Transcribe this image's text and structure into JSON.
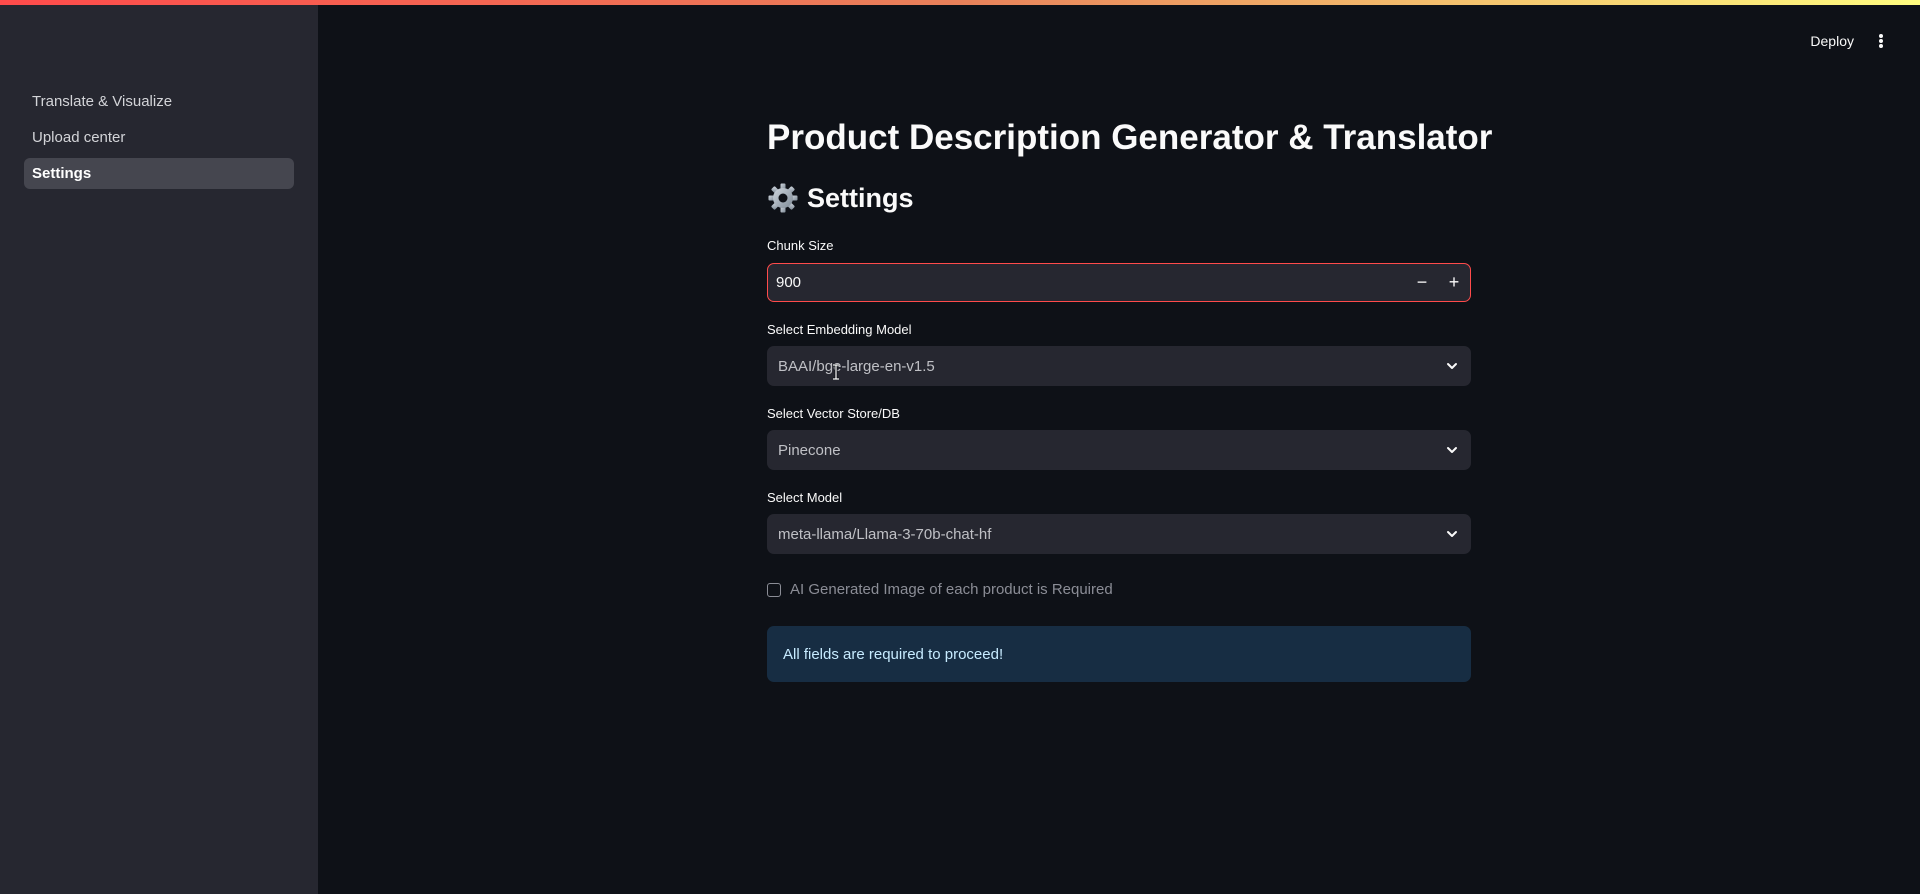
{
  "sidebar": {
    "items": [
      {
        "label": "Translate & Visualize",
        "active": false
      },
      {
        "label": "Upload center",
        "active": false
      },
      {
        "label": "Settings",
        "active": true
      }
    ]
  },
  "header": {
    "deploy_label": "Deploy",
    "menu_icon": "vertical-ellipsis-icon"
  },
  "main": {
    "title": "Product Description Generator & Translator",
    "section_title": "Settings",
    "section_icon": "gear-icon",
    "chunk_size": {
      "label": "Chunk Size",
      "value": "900",
      "decrement_label": "−",
      "increment_label": "+"
    },
    "embedding_model": {
      "label": "Select Embedding Model",
      "value": "BAAI/bge-large-en-v1.5"
    },
    "vector_store": {
      "label": "Select Vector Store/DB",
      "value": "Pinecone"
    },
    "model": {
      "label": "Select Model",
      "value": "meta-llama/Llama-3-70b-chat-hf"
    },
    "image_checkbox": {
      "label": "AI Generated Image of each product is Required",
      "checked": false
    },
    "alert": "All fields are required to proceed!"
  },
  "colors": {
    "background": "#0e1117",
    "sidebar": "#262730",
    "accent": "#ff4b4b",
    "info_bg": "#172d43",
    "info_text": "#c7ebff"
  }
}
